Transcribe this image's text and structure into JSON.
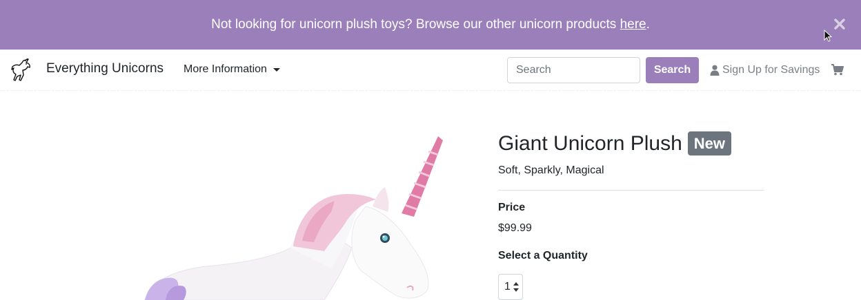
{
  "banner": {
    "text_before": "Not looking for unicorn plush toys? Browse our other unicorn products ",
    "link_text": "here",
    "text_after": "."
  },
  "navbar": {
    "brand": "Everything Unicorns",
    "more_info": "More Information",
    "search_placeholder": "Search",
    "search_button": "Search",
    "signup": "Sign Up for Savings"
  },
  "product": {
    "title": "Giant Unicorn Plush",
    "badge": "New",
    "subtitle": "Soft, Sparkly, Magical",
    "price_label": "Price",
    "price": "$99.99",
    "quantity_label": "Select a Quantity",
    "quantity_value": "1"
  },
  "colors": {
    "accent": "#9b7fba",
    "badge": "#6c757d",
    "muted_text": "#7a7f85"
  },
  "icons": [
    "close-icon",
    "cursor-icon",
    "unicorn-logo-icon",
    "chevron-down-icon",
    "user-icon",
    "cart-icon",
    "select-arrows-icon"
  ]
}
